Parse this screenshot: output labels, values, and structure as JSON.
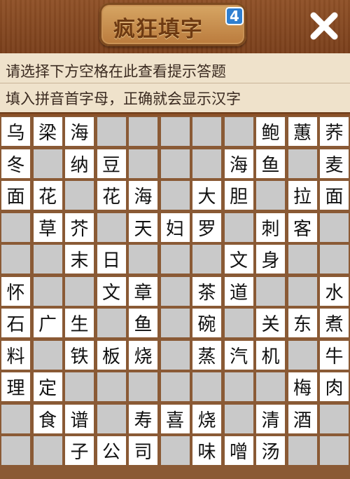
{
  "app": {
    "title": "疯狂填字",
    "badge": "4"
  },
  "hints": {
    "line1": "请选择下方空格在此查看提示答题",
    "line2": "填入拼音首字母，正确就会显示汉字"
  },
  "colors": {
    "wood": "#8a4f26",
    "white_cell": "#ffffff",
    "gray_cell": "#c9c9c9",
    "hint_bg": "#efe2cb"
  },
  "grid": {
    "cols": 11,
    "rows": 11,
    "cells": [
      [
        "乌",
        "梁",
        "海",
        "#",
        "#",
        "#",
        "#",
        "#",
        "鲍",
        "蕙",
        "荞"
      ],
      [
        "冬",
        "#",
        "纳",
        "豆",
        "#",
        "#",
        "#",
        "海",
        "鱼",
        "#",
        "麦"
      ],
      [
        "面",
        "花",
        "#",
        "花",
        "海",
        "#",
        "大",
        "胆",
        "#",
        "拉",
        "面"
      ],
      [
        "#",
        "草",
        "芥",
        "#",
        "天",
        "妇",
        "罗",
        "#",
        "刺",
        "客",
        "#"
      ],
      [
        "#",
        "#",
        "末",
        "日",
        "#",
        "#",
        "#",
        "文",
        "身",
        "#",
        "#"
      ],
      [
        "怀",
        "#",
        "#",
        "文",
        "章",
        "#",
        "茶",
        "道",
        "#",
        "#",
        "水"
      ],
      [
        "石",
        "广",
        "生",
        "#",
        "鱼",
        "#",
        "碗",
        "#",
        "关",
        "东",
        "煮"
      ],
      [
        "料",
        "#",
        "铁",
        "板",
        "烧",
        "#",
        "蒸",
        "汽",
        "机",
        "#",
        "牛"
      ],
      [
        "理",
        "定",
        "#",
        "#",
        "#",
        "#",
        "#",
        "#",
        "#",
        "梅",
        "肉"
      ],
      [
        "#",
        "食",
        "谱",
        "#",
        "寿",
        "喜",
        "烧",
        "#",
        "清",
        "酒",
        "#"
      ],
      [
        "#",
        "#",
        "子",
        "公",
        "司",
        "#",
        "味",
        "噌",
        "汤",
        "#",
        "#"
      ]
    ]
  }
}
